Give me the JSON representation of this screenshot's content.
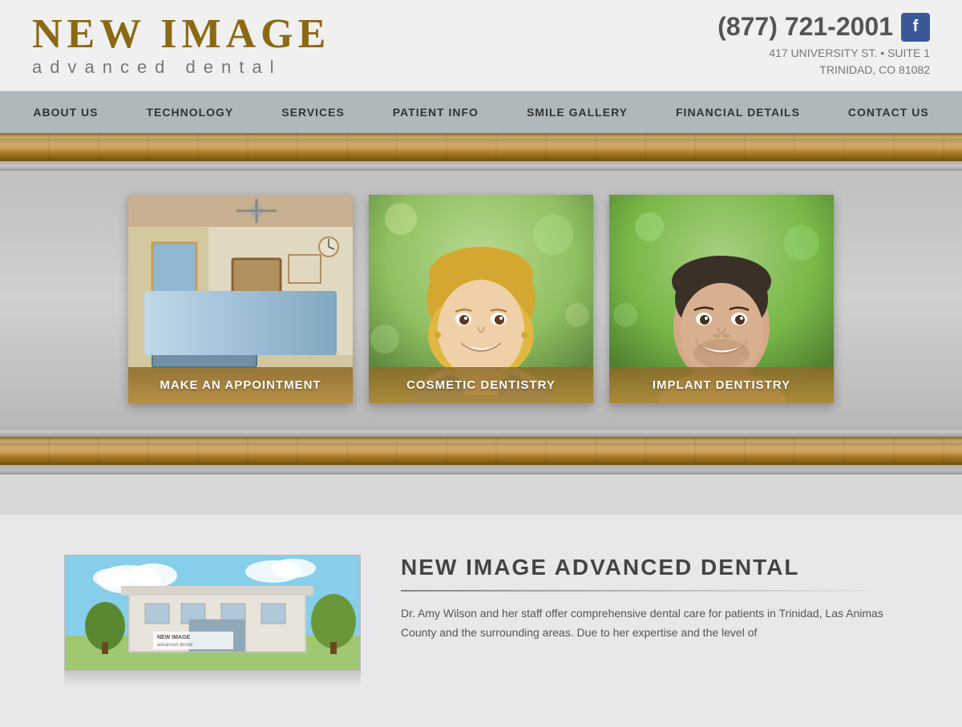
{
  "header": {
    "logo_title": "NEW IMAGE",
    "logo_subtitle": "advanced dental",
    "phone": "(877) 721-2001",
    "address_line1": "417 UNIVERSITY ST. • SUITE 1",
    "address_line2": "TRINIDAD, CO 81082",
    "facebook_label": "f"
  },
  "nav": {
    "items": [
      {
        "label": "ABOUT US",
        "id": "about-us"
      },
      {
        "label": "TECHNOLOGY",
        "id": "technology"
      },
      {
        "label": "SERVICES",
        "id": "services"
      },
      {
        "label": "PATIENT INFO",
        "id": "patient-info"
      },
      {
        "label": "SMILE GALLERY",
        "id": "smile-gallery"
      },
      {
        "label": "FINANCIAL DETAILS",
        "id": "financial-details"
      },
      {
        "label": "CONTACT US",
        "id": "contact-us"
      }
    ]
  },
  "hero": {
    "cards": [
      {
        "label": "MAKE AN APPOINTMENT",
        "id": "appointment"
      },
      {
        "label": "COSMETIC DENTISTRY",
        "id": "cosmetic"
      },
      {
        "label": "IMPLANT DENTISTRY",
        "id": "implant"
      }
    ]
  },
  "about": {
    "title": "NEW IMAGE ADVANCED DENTAL",
    "body": "Dr. Amy Wilson and her staff offer comprehensive dental care for patients in Trinidad, Las Animas County and the surrounding areas. Due to her expertise and the level of"
  }
}
